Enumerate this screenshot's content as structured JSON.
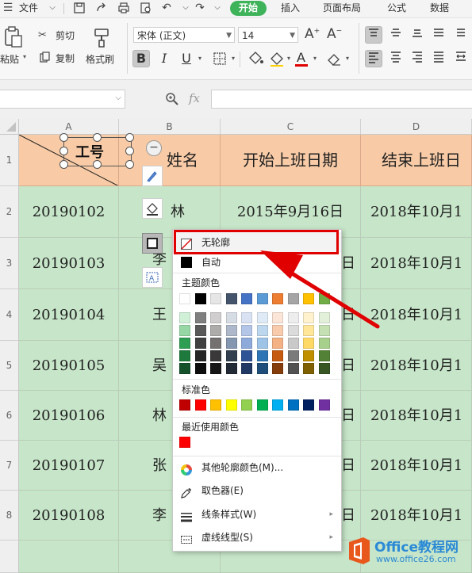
{
  "menubar": {
    "file_label": "文件",
    "tabs": [
      {
        "label": "开始",
        "active": true
      },
      {
        "label": "插入"
      },
      {
        "label": "页面布局"
      },
      {
        "label": "公式"
      },
      {
        "label": "数据"
      }
    ]
  },
  "ribbon": {
    "paste_label": "粘贴",
    "cut_label": "剪切",
    "copy_label": "复制",
    "format_painter_label": "格式刷",
    "font_name": "宋体 (正文)",
    "font_size": "14",
    "bold_active": true
  },
  "formula_bar": {
    "fx_label": "fx",
    "name_box_value": "",
    "formula_value": ""
  },
  "sheet": {
    "columns": [
      "A",
      "B",
      "C",
      "D"
    ],
    "rows": [
      "1",
      "2",
      "3",
      "4",
      "5",
      "6",
      "7",
      "8"
    ],
    "header_row": {
      "a": "工号",
      "b": "姓名",
      "c": "开始上班日期",
      "d": "结束上班日"
    },
    "data_rows": [
      {
        "id": "20190102",
        "name": "林",
        "start": "2015年9月16日",
        "end": "2018年10月1"
      },
      {
        "id": "20190103",
        "name": "李",
        "start": "日",
        "end": "2018年10月1"
      },
      {
        "id": "20190104",
        "name": "王",
        "start": "日",
        "end": "2018年10月1"
      },
      {
        "id": "20190105",
        "name": "吴",
        "start": "日",
        "end": "2018年10月1"
      },
      {
        "id": "20190106",
        "name": "林",
        "start": "日",
        "end": "2018年10月1"
      },
      {
        "id": "20190107",
        "name": "张",
        "start": "日",
        "end": "2018年10月1"
      },
      {
        "id": "20190108",
        "name": "李",
        "start": "日",
        "end": "2018年10月1"
      }
    ]
  },
  "outline_menu": {
    "no_outline": "无轮廓",
    "auto": "自动",
    "theme_colors_label": "主题颜色",
    "theme_top_row": [
      "#ffffff",
      "#000000",
      "#e7e6e6",
      "#44546a",
      "#4472c4",
      "#5b9bd5",
      "#ed7d31",
      "#a5a5a5",
      "#ffc000",
      "#70ad47"
    ],
    "theme_shades": [
      [
        "#d0f0d8",
        "#7f7f7f",
        "#d0cece",
        "#d6dce4",
        "#d9e2f3",
        "#deebf6",
        "#fbe5d6",
        "#ededed",
        "#fff2cc",
        "#e2efd9"
      ],
      [
        "#96d7a5",
        "#595959",
        "#aeabab",
        "#adb9ca",
        "#b4c6e7",
        "#bdd7ee",
        "#f8cbad",
        "#dbdbdb",
        "#ffe699",
        "#c5e0b3"
      ],
      [
        "#2e9e52",
        "#404040",
        "#757171",
        "#8496b0",
        "#8eaadb",
        "#9dc3e6",
        "#f4b183",
        "#c9c9c9",
        "#ffd966",
        "#a8d08d"
      ],
      [
        "#1e7a3c",
        "#262626",
        "#3a3838",
        "#323f4f",
        "#2f5496",
        "#2e75b5",
        "#c55a11",
        "#7b7b7b",
        "#bf8f00",
        "#538135"
      ],
      [
        "#14502a",
        "#0d0d0d",
        "#171616",
        "#222a35",
        "#1f3864",
        "#1e4e79",
        "#843c0b",
        "#525252",
        "#7f6000",
        "#375623"
      ]
    ],
    "standard_colors_label": "标准色",
    "standard_colors": [
      "#c00000",
      "#ff0000",
      "#ffc000",
      "#ffff00",
      "#92d050",
      "#00b050",
      "#00b0f0",
      "#0070c0",
      "#002060",
      "#7030a0"
    ],
    "recent_colors_label": "最近使用颜色",
    "recent_colors": [
      "#ff0000"
    ],
    "more_colors": "其他轮廓颜色(M)...",
    "eyedropper": "取色器(E)",
    "line_style": "线条样式(W)",
    "dash_style": "虚线线型(S)"
  },
  "watermark": {
    "brand": "Office教程网",
    "url": "www.office26.com"
  },
  "colors": {
    "accent_green": "#3eb35a",
    "header_fill": "#f8cba6",
    "body_fill": "#c7e6c9",
    "highlight_red": "#e00000"
  }
}
